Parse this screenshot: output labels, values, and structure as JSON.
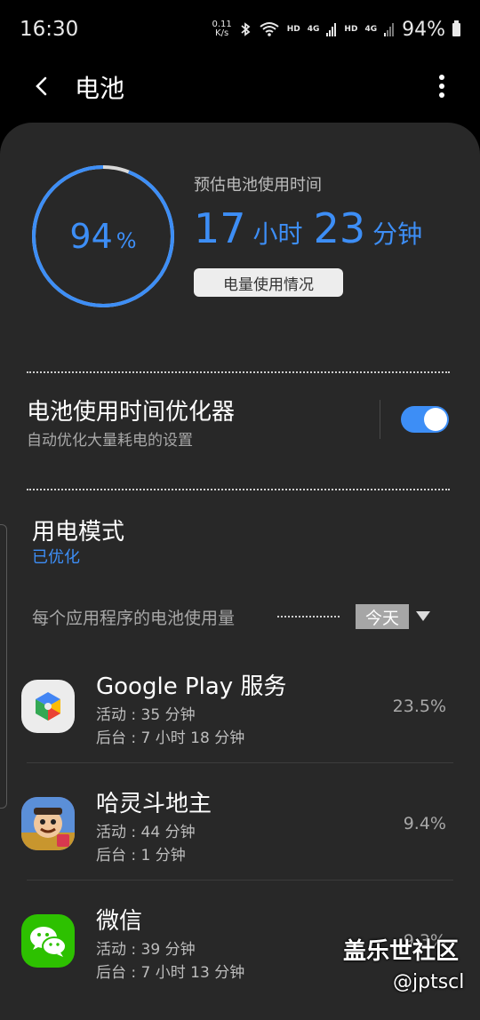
{
  "status_bar": {
    "time": "16:30",
    "net_speed_value": "0.11",
    "net_speed_unit": "K/s",
    "hd1": "HD",
    "net1": "4G",
    "hd2": "HD",
    "net2": "4G",
    "battery_percent": "94%"
  },
  "header": {
    "title": "电池"
  },
  "battery": {
    "level": 0.94,
    "percent_value": "94",
    "percent_unit": "%",
    "estimate_label": "预估电池使用时间",
    "hours_value": "17",
    "hours_unit": "小时",
    "minutes_value": "23",
    "minutes_unit": "分钟",
    "usage_button_label": "电量使用情况"
  },
  "optimizer": {
    "title": "电池使用时间优化器",
    "subtitle": "自动优化大量耗电的设置",
    "enabled": true
  },
  "power_mode": {
    "title": "用电模式",
    "value": "已优化"
  },
  "per_app": {
    "label": "每个应用程序的电池使用量",
    "period": "今天"
  },
  "apps": [
    {
      "name": "Google Play 服务",
      "active": "活动 : 35 分钟",
      "background": "后台 : 7 小时 18 分钟",
      "percent": "23.5%"
    },
    {
      "name": "哈灵斗地主",
      "active": "活动 : 44 分钟",
      "background": "后台 : 1 分钟",
      "percent": "9.4%"
    },
    {
      "name": "微信",
      "active": "活动 : 39 分钟",
      "background": "后台 : 7 小时 13 分钟",
      "percent": "9.3%"
    }
  ],
  "watermark": {
    "line1": "盖乐世社区",
    "line2": "@jptscl"
  },
  "colors": {
    "accent": "#3d8ef6",
    "card_bg": "#282828",
    "wechat_green": "#2dc100"
  }
}
